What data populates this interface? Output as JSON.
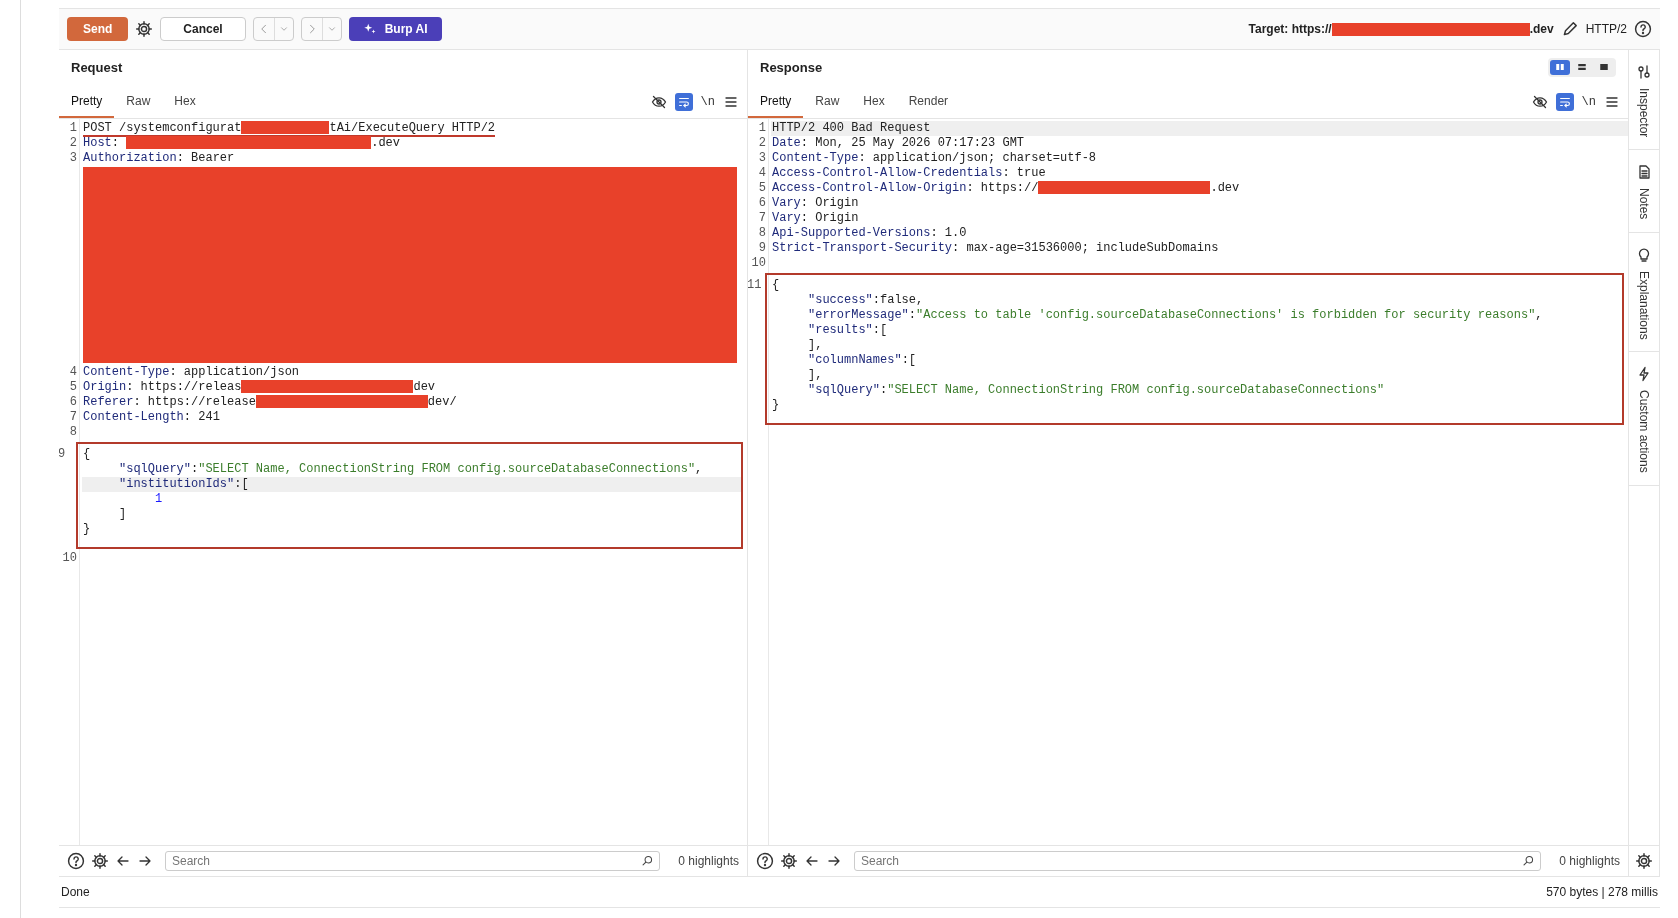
{
  "toolbar": {
    "send": "Send",
    "cancel": "Cancel",
    "ai": "Burp AI",
    "target_label": "Target: https://",
    "target_suffix": ".dev",
    "protocol": "HTTP/2"
  },
  "request": {
    "title": "Request",
    "tabs": [
      {
        "label": "Pretty",
        "selected": true
      },
      {
        "label": "Raw",
        "selected": false
      },
      {
        "label": "Hex",
        "selected": false
      }
    ],
    "wrap": true,
    "newline_label": "\\n",
    "lines": [
      {
        "kind": "code",
        "number": "1",
        "current": false,
        "flagged": true,
        "parts": [
          {
            "kind": "plain",
            "text": "POST /systemconfigurat"
          },
          {
            "kind": "redacted-short"
          },
          {
            "kind": "plain",
            "text": "tAi/ExecuteQuery HTTP/2"
          }
        ]
      },
      {
        "kind": "code",
        "number": "2",
        "current": false,
        "flagged": false,
        "parts": [
          {
            "kind": "name",
            "text": "Host"
          },
          {
            "kind": "plain",
            "text": ": "
          },
          {
            "kind": "redacted-long"
          },
          {
            "kind": "plain",
            "text": ".dev"
          }
        ]
      },
      {
        "kind": "code",
        "number": "3",
        "current": false,
        "flagged": false,
        "parts": [
          {
            "kind": "name",
            "text": "Authorization"
          },
          {
            "kind": "plain",
            "text": ": Bearer"
          }
        ]
      },
      {
        "kind": "redacted-block"
      },
      {
        "kind": "code",
        "number": "4",
        "current": false,
        "flagged": false,
        "parts": [
          {
            "kind": "name",
            "text": "Content-Type"
          },
          {
            "kind": "plain",
            "text": ": application/json"
          }
        ]
      },
      {
        "kind": "code",
        "number": "5",
        "current": false,
        "flagged": false,
        "parts": [
          {
            "kind": "name",
            "text": "Origin"
          },
          {
            "kind": "plain",
            "text": ": https://releas"
          },
          {
            "kind": "redacted-medium"
          },
          {
            "kind": "plain",
            "text": "dev"
          }
        ]
      },
      {
        "kind": "code",
        "number": "6",
        "current": false,
        "flagged": false,
        "parts": [
          {
            "kind": "name",
            "text": "Referer"
          },
          {
            "kind": "plain",
            "text": ": https://release"
          },
          {
            "kind": "redacted-medium"
          },
          {
            "kind": "plain",
            "text": "dev/"
          }
        ]
      },
      {
        "kind": "code",
        "number": "7",
        "current": false,
        "flagged": false,
        "parts": [
          {
            "kind": "name",
            "text": "Content-Length"
          },
          {
            "kind": "plain",
            "text": ": 241"
          }
        ]
      },
      {
        "kind": "code",
        "number": "8"
      },
      {
        "kind": "box",
        "children": [
          {
            "kind": "code",
            "number": "9",
            "current": false,
            "flagged": false,
            "parts": [
              {
                "kind": "plain",
                "text": "{"
              }
            ]
          },
          {
            "kind": "code",
            "current": false,
            "flagged": false,
            "parts": [
              {
                "kind": "indent"
              },
              {
                "kind": "key",
                "text": "\"sqlQuery\""
              },
              {
                "kind": "plain",
                "text": ":"
              },
              {
                "kind": "string",
                "text": "\"SELECT Name, ConnectionString FROM config.sourceDatabaseConnections\""
              },
              {
                "kind": "plain",
                "text": ","
              }
            ]
          },
          {
            "kind": "code",
            "current": true,
            "flagged": false,
            "parts": [
              {
                "kind": "indent"
              },
              {
                "kind": "key",
                "text": "\"institutionIds\""
              },
              {
                "kind": "plain",
                "text": ":["
              }
            ]
          },
          {
            "kind": "code",
            "current": false,
            "flagged": false,
            "parts": [
              {
                "kind": "indent"
              },
              {
                "kind": "indent"
              },
              {
                "kind": "number",
                "text": "1"
              }
            ]
          },
          {
            "kind": "code",
            "current": false,
            "flagged": false,
            "parts": [
              {
                "kind": "indent"
              },
              {
                "kind": "plain",
                "text": "]"
              }
            ]
          },
          {
            "kind": "code",
            "current": false,
            "flagged": false,
            "parts": [
              {
                "kind": "plain",
                "text": "}"
              }
            ]
          }
        ]
      },
      {
        "kind": "code",
        "number": "10"
      }
    ],
    "search": {
      "placeholder": "Search"
    },
    "highlights": "0 highlights"
  },
  "response": {
    "title": "Response",
    "layout_modes": [
      {
        "kind": "split",
        "selected": true
      },
      {
        "kind": "stacked",
        "selected": false
      },
      {
        "kind": "single",
        "selected": false
      }
    ],
    "tabs": [
      {
        "label": "Pretty",
        "selected": true
      },
      {
        "label": "Raw",
        "selected": false
      },
      {
        "label": "Hex",
        "selected": false
      },
      {
        "label": "Render",
        "selected": false
      }
    ],
    "wrap": true,
    "newline_label": "\\n",
    "lines": [
      {
        "kind": "code",
        "number": "1",
        "current": true,
        "flagged": false,
        "parts": [
          {
            "kind": "plain",
            "text": "HTTP/2 400 Bad Request"
          }
        ]
      },
      {
        "kind": "code",
        "number": "2",
        "current": false,
        "flagged": false,
        "parts": [
          {
            "kind": "name",
            "text": "Date"
          },
          {
            "kind": "plain",
            "text": ": Mon, 25 May 2026 07:17:23 GMT"
          }
        ]
      },
      {
        "kind": "code",
        "number": "3",
        "current": false,
        "flagged": false,
        "parts": [
          {
            "kind": "name",
            "text": "Content-Type"
          },
          {
            "kind": "plain",
            "text": ": application/json; charset=utf-8"
          }
        ]
      },
      {
        "kind": "code",
        "number": "4",
        "current": false,
        "flagged": false,
        "parts": [
          {
            "kind": "name",
            "text": "Access-Control-Allow-Credentials"
          },
          {
            "kind": "plain",
            "text": ": true"
          }
        ]
      },
      {
        "kind": "code",
        "number": "5",
        "current": false,
        "flagged": false,
        "parts": [
          {
            "kind": "name",
            "text": "Access-Control-Allow-Origin"
          },
          {
            "kind": "plain",
            "text": ": https://"
          },
          {
            "kind": "redacted-medium"
          },
          {
            "kind": "plain",
            "text": ".dev"
          }
        ]
      },
      {
        "kind": "code",
        "number": "6",
        "current": false,
        "flagged": false,
        "parts": [
          {
            "kind": "name",
            "text": "Vary"
          },
          {
            "kind": "plain",
            "text": ": Origin"
          }
        ]
      },
      {
        "kind": "code",
        "number": "7",
        "current": false,
        "flagged": false,
        "parts": [
          {
            "kind": "name",
            "text": "Vary"
          },
          {
            "kind": "plain",
            "text": ": Origin"
          }
        ]
      },
      {
        "kind": "code",
        "number": "8",
        "current": false,
        "flagged": false,
        "parts": [
          {
            "kind": "name",
            "text": "Api-Supported-Versions"
          },
          {
            "kind": "plain",
            "text": ": 1.0"
          }
        ]
      },
      {
        "kind": "code",
        "number": "9",
        "current": false,
        "flagged": false,
        "parts": [
          {
            "kind": "name",
            "text": "Strict-Transport-Security"
          },
          {
            "kind": "plain",
            "text": ": max-age=31536000; includeSubDomains"
          }
        ]
      },
      {
        "kind": "code",
        "number": "10"
      },
      {
        "kind": "box",
        "children": [
          {
            "kind": "code",
            "number": "11",
            "current": false,
            "flagged": false,
            "parts": [
              {
                "kind": "plain",
                "text": "{"
              }
            ]
          },
          {
            "kind": "code",
            "current": false,
            "flagged": false,
            "parts": [
              {
                "kind": "indent"
              },
              {
                "kind": "key",
                "text": "\"success\""
              },
              {
                "kind": "plain",
                "text": ":false,"
              }
            ]
          },
          {
            "kind": "code",
            "current": false,
            "flagged": false,
            "parts": [
              {
                "kind": "indent"
              },
              {
                "kind": "key",
                "text": "\"errorMessage\""
              },
              {
                "kind": "plain",
                "text": ":"
              },
              {
                "kind": "string",
                "text": "\"Access to table 'config.sourceDatabaseConnections' is forbidden for security reasons\""
              },
              {
                "kind": "plain",
                "text": ","
              }
            ]
          },
          {
            "kind": "code",
            "current": false,
            "flagged": false,
            "parts": [
              {
                "kind": "indent"
              },
              {
                "kind": "key",
                "text": "\"results\""
              },
              {
                "kind": "plain",
                "text": ":["
              }
            ]
          },
          {
            "kind": "code",
            "current": false,
            "flagged": false,
            "parts": [
              {
                "kind": "indent"
              },
              {
                "kind": "plain",
                "text": "],"
              }
            ]
          },
          {
            "kind": "code",
            "current": false,
            "flagged": false,
            "parts": [
              {
                "kind": "indent"
              },
              {
                "kind": "key",
                "text": "\"columnNames\""
              },
              {
                "kind": "plain",
                "text": ":["
              }
            ]
          },
          {
            "kind": "code",
            "current": false,
            "flagged": false,
            "parts": [
              {
                "kind": "indent"
              },
              {
                "kind": "plain",
                "text": "],"
              }
            ]
          },
          {
            "kind": "code",
            "current": false,
            "flagged": false,
            "parts": [
              {
                "kind": "indent"
              },
              {
                "kind": "key",
                "text": "\"sqlQuery\""
              },
              {
                "kind": "plain",
                "text": ":"
              },
              {
                "kind": "string",
                "text": "\"SELECT Name, ConnectionString FROM config.sourceDatabaseConnections\""
              }
            ]
          },
          {
            "kind": "code",
            "current": false,
            "flagged": false,
            "parts": [
              {
                "kind": "plain",
                "text": "}"
              }
            ]
          }
        ]
      }
    ],
    "search": {
      "placeholder": "Search"
    },
    "highlights": "0 highlights"
  },
  "sidebar": {
    "items": [
      {
        "kind": "inspector",
        "label": "Inspector"
      },
      {
        "kind": "notes",
        "label": "Notes"
      },
      {
        "kind": "explanations",
        "label": "Explanations"
      },
      {
        "kind": "custom-actions",
        "label": "Custom actions"
      }
    ]
  },
  "status_bar": {
    "left": "Done",
    "right": "570 bytes | 278 millis"
  }
}
